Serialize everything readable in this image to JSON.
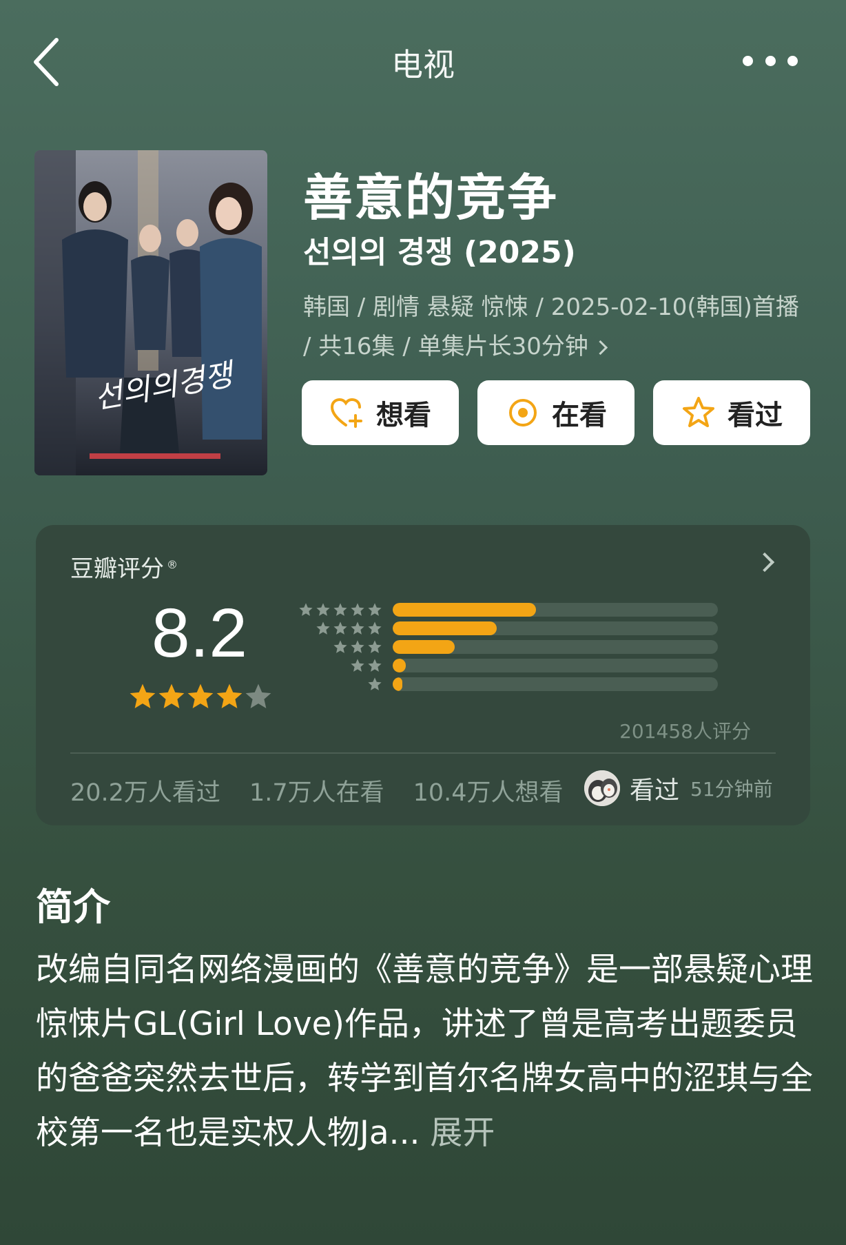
{
  "nav": {
    "title": "电视"
  },
  "show": {
    "title": "善意的竞争",
    "original_title": "선의의 경쟁 (2025)",
    "meta": "韩国 / 剧情 悬疑 惊悚 / 2025-02-10(韩国)首播 / 共16集 / 单集片长30分钟",
    "poster_text": "선의의경쟁"
  },
  "actions": [
    {
      "label": "想看",
      "icon": "heart-plus-icon"
    },
    {
      "label": "在看",
      "icon": "target-icon"
    },
    {
      "label": "看过",
      "icon": "star-outline-icon"
    }
  ],
  "rating": {
    "header": "豆瓣评分",
    "header_mark": "®",
    "score": "8.2",
    "stars": 4,
    "distribution": [
      {
        "stars": 5,
        "percent": 44
      },
      {
        "stars": 4,
        "percent": 32
      },
      {
        "stars": 3,
        "percent": 19
      },
      {
        "stars": 2,
        "percent": 4
      },
      {
        "stars": 1,
        "percent": 1.5
      }
    ],
    "count_text": "201458人评分",
    "watched": "20.2万人看过",
    "watching": "1.7万人在看",
    "wish": "10.4万人想看",
    "friend_status": "看过",
    "friend_time": "51分钟前"
  },
  "intro": {
    "title": "简介",
    "text": "改编自同名网络漫画的《善意的竞争》是一部悬疑心理惊悚片GL(Girl Love)作品，讲述了曾是高考出题委员的爸爸突然去世后，转学到首尔名牌女高中的涩琪与全校第一名也是实权人物Ja... ",
    "expand": "展开"
  },
  "colors": {
    "accent": "#f3a515",
    "card": "#34483d"
  }
}
